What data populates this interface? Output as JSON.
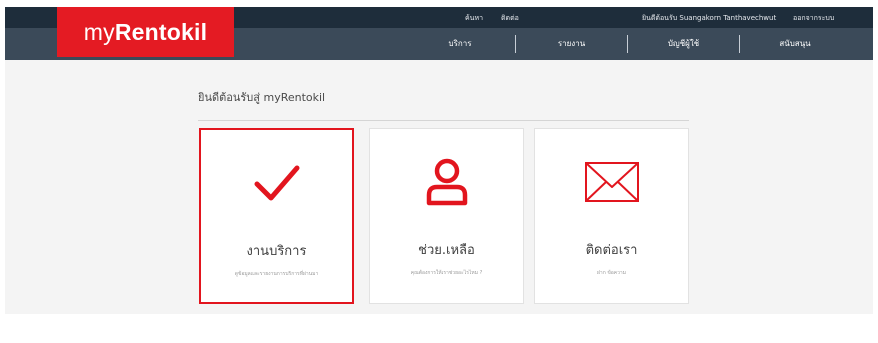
{
  "header": {
    "logo": {
      "prefix": "my",
      "brand": "Rentokil"
    },
    "utility_links": [
      "ค้นหา",
      "ติดต่อ",
      "ยินดีต้อนรับ Suangakorn Tanthavechwut",
      "ออกจากระบบ"
    ],
    "nav_items": [
      "บริการ",
      "รายงาน",
      "บัญชีผู้ใช้",
      "สนับสนุน"
    ]
  },
  "main": {
    "welcome_text": "ยินดีต้อนรับสู่ myRentokil",
    "cards": [
      {
        "title": "งานบริการ",
        "subtitle": "ดูข้อมูลและรายงานการบริการที่ผ่านมา",
        "icon": "checkmark-icon",
        "selected": true
      },
      {
        "title": "ช่วย.เหลือ",
        "subtitle": "คุณต้องการให้เราช่วยอะไรไหม ?",
        "icon": "user-icon",
        "selected": false
      },
      {
        "title": "ติดต่อเรา",
        "subtitle": "ฝาก ข้อความ",
        "icon": "envelope-icon",
        "selected": false
      }
    ]
  },
  "colors": {
    "brand_red": "#e41b23",
    "topbar": "#1e2d3b",
    "navbar": "#3b4a59",
    "highlight": "#e2151e"
  }
}
